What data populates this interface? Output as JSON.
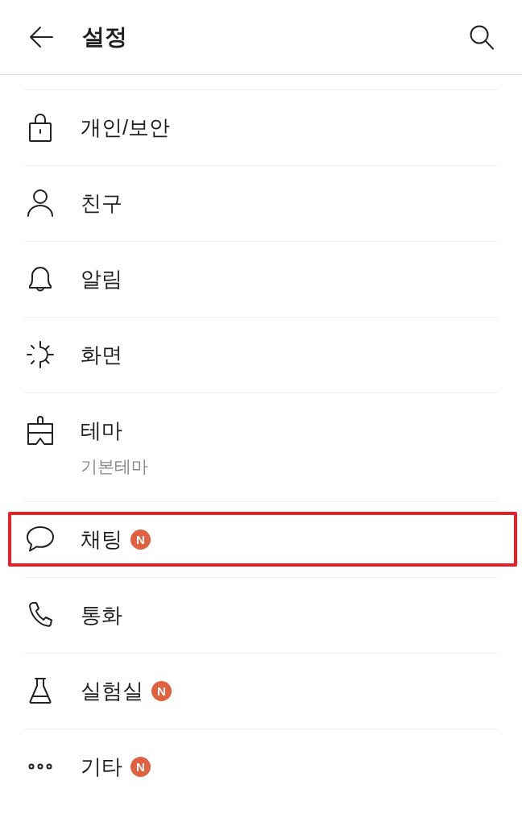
{
  "header": {
    "title": "설정"
  },
  "items": [
    {
      "label": "개인/보안",
      "highlighted": false
    },
    {
      "label": "친구",
      "highlighted": false
    },
    {
      "label": "알림",
      "highlighted": false
    },
    {
      "label": "화면",
      "highlighted": false
    },
    {
      "label": "테마",
      "subtitle": "기본테마",
      "highlighted": false
    },
    {
      "label": "채팅",
      "badge": "N",
      "highlighted": true
    },
    {
      "label": "통화",
      "highlighted": false
    },
    {
      "label": "실험실",
      "badge": "N",
      "highlighted": false
    },
    {
      "label": "기타",
      "badge": "N",
      "highlighted": false
    }
  ]
}
